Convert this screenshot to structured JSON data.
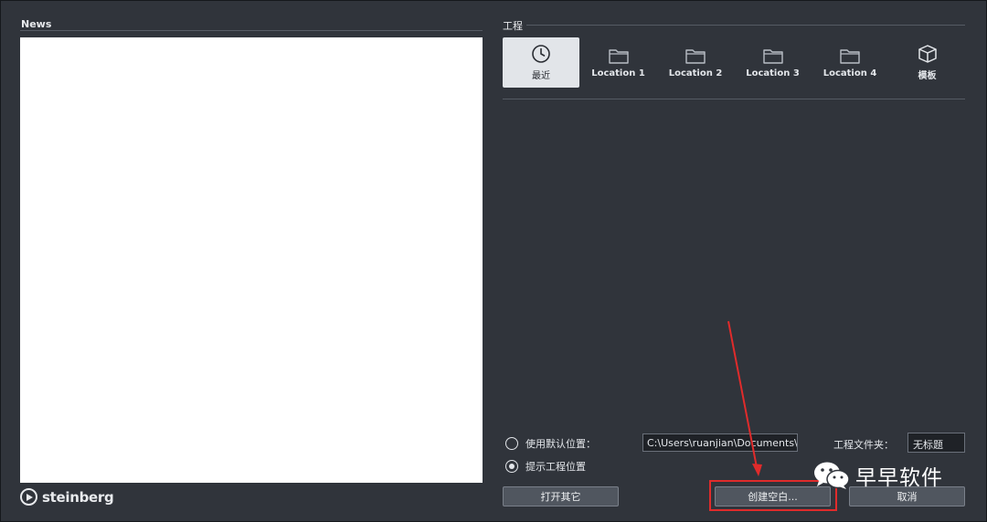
{
  "news": {
    "title": "News"
  },
  "brand": {
    "logo_text": "steinberg"
  },
  "projects": {
    "title": "工程",
    "tabs": [
      {
        "label": "最近",
        "icon": "clock-icon",
        "active": true
      },
      {
        "label": "Location 1",
        "icon": "folder-icon",
        "active": false
      },
      {
        "label": "Location 2",
        "icon": "folder-icon",
        "active": false
      },
      {
        "label": "Location 3",
        "icon": "folder-icon",
        "active": false
      },
      {
        "label": "Location 4",
        "icon": "folder-icon",
        "active": false
      },
      {
        "label": "模板",
        "icon": "box-icon",
        "active": false
      }
    ]
  },
  "location_options": {
    "use_default_label": "使用默认位置：",
    "use_default_selected": false,
    "prompt_label": "提示工程位置",
    "prompt_selected": true,
    "default_path": "C:\\Users\\ruanjian\\Documents\\N.",
    "folder_label": "工程文件夹：",
    "folder_name": "无标题"
  },
  "buttons": {
    "open_other": "打开其它",
    "create_empty": "创建空白...",
    "cancel": "取消"
  },
  "watermark": {
    "text": "早早软件"
  },
  "colors": {
    "background": "#30343b",
    "annotation": "#e02b2b",
    "active_tab": "#e2e5e9"
  }
}
